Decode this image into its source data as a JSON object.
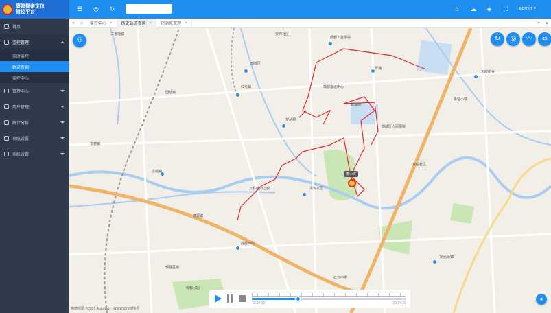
{
  "app": {
    "title_line1": "康盈探亲定位",
    "title_line2": "管控平台",
    "admin": "admin ▾"
  },
  "sidebar": {
    "items": [
      {
        "label": "首页"
      },
      {
        "label": "监控管理",
        "sub": [
          "实时监控",
          "轨迹查询",
          "监控中心"
        ]
      },
      {
        "label": "管理中心"
      },
      {
        "label": "用户管理"
      },
      {
        "label": "统计分析"
      },
      {
        "label": "系统设置"
      },
      {
        "label": "系统设置"
      }
    ]
  },
  "tabs": {
    "items": [
      {
        "label": "监控中心"
      },
      {
        "label": "历史轨迹查询"
      },
      {
        "label": "短消息管理"
      }
    ]
  },
  "map": {
    "labels": [
      {
        "t": "郫都区"
      },
      {
        "t": "天府社区"
      },
      {
        "t": "成都工业学院"
      },
      {
        "t": "犀浦"
      },
      {
        "t": "团结镇"
      },
      {
        "t": "红光镇"
      },
      {
        "t": "安德镇"
      },
      {
        "t": "三道堰镇"
      },
      {
        "t": "犀浦站"
      },
      {
        "t": "郫都客运中心"
      },
      {
        "t": "望丛祠"
      },
      {
        "t": "郫都区人民医院"
      },
      {
        "t": "清河公园"
      },
      {
        "t": "古城镇"
      },
      {
        "t": "德源镇"
      },
      {
        "t": "双柏社区"
      },
      {
        "t": "万科魅力之城"
      },
      {
        "t": "新民场镇"
      },
      {
        "t": "成都西站"
      },
      {
        "t": "菁蓉小镇"
      },
      {
        "t": "郫县豆瓣"
      },
      {
        "t": "红光中学"
      },
      {
        "t": "天府新谷"
      },
      {
        "t": "郫都公园"
      }
    ],
    "tooltip": "唐小洪"
  },
  "player": {
    "start": "19:24:30",
    "end": "19:24:16",
    "progress": 0.3
  },
  "copyright": "高德地图 ©2021 AutoNavi - GS(2019)6379号"
}
